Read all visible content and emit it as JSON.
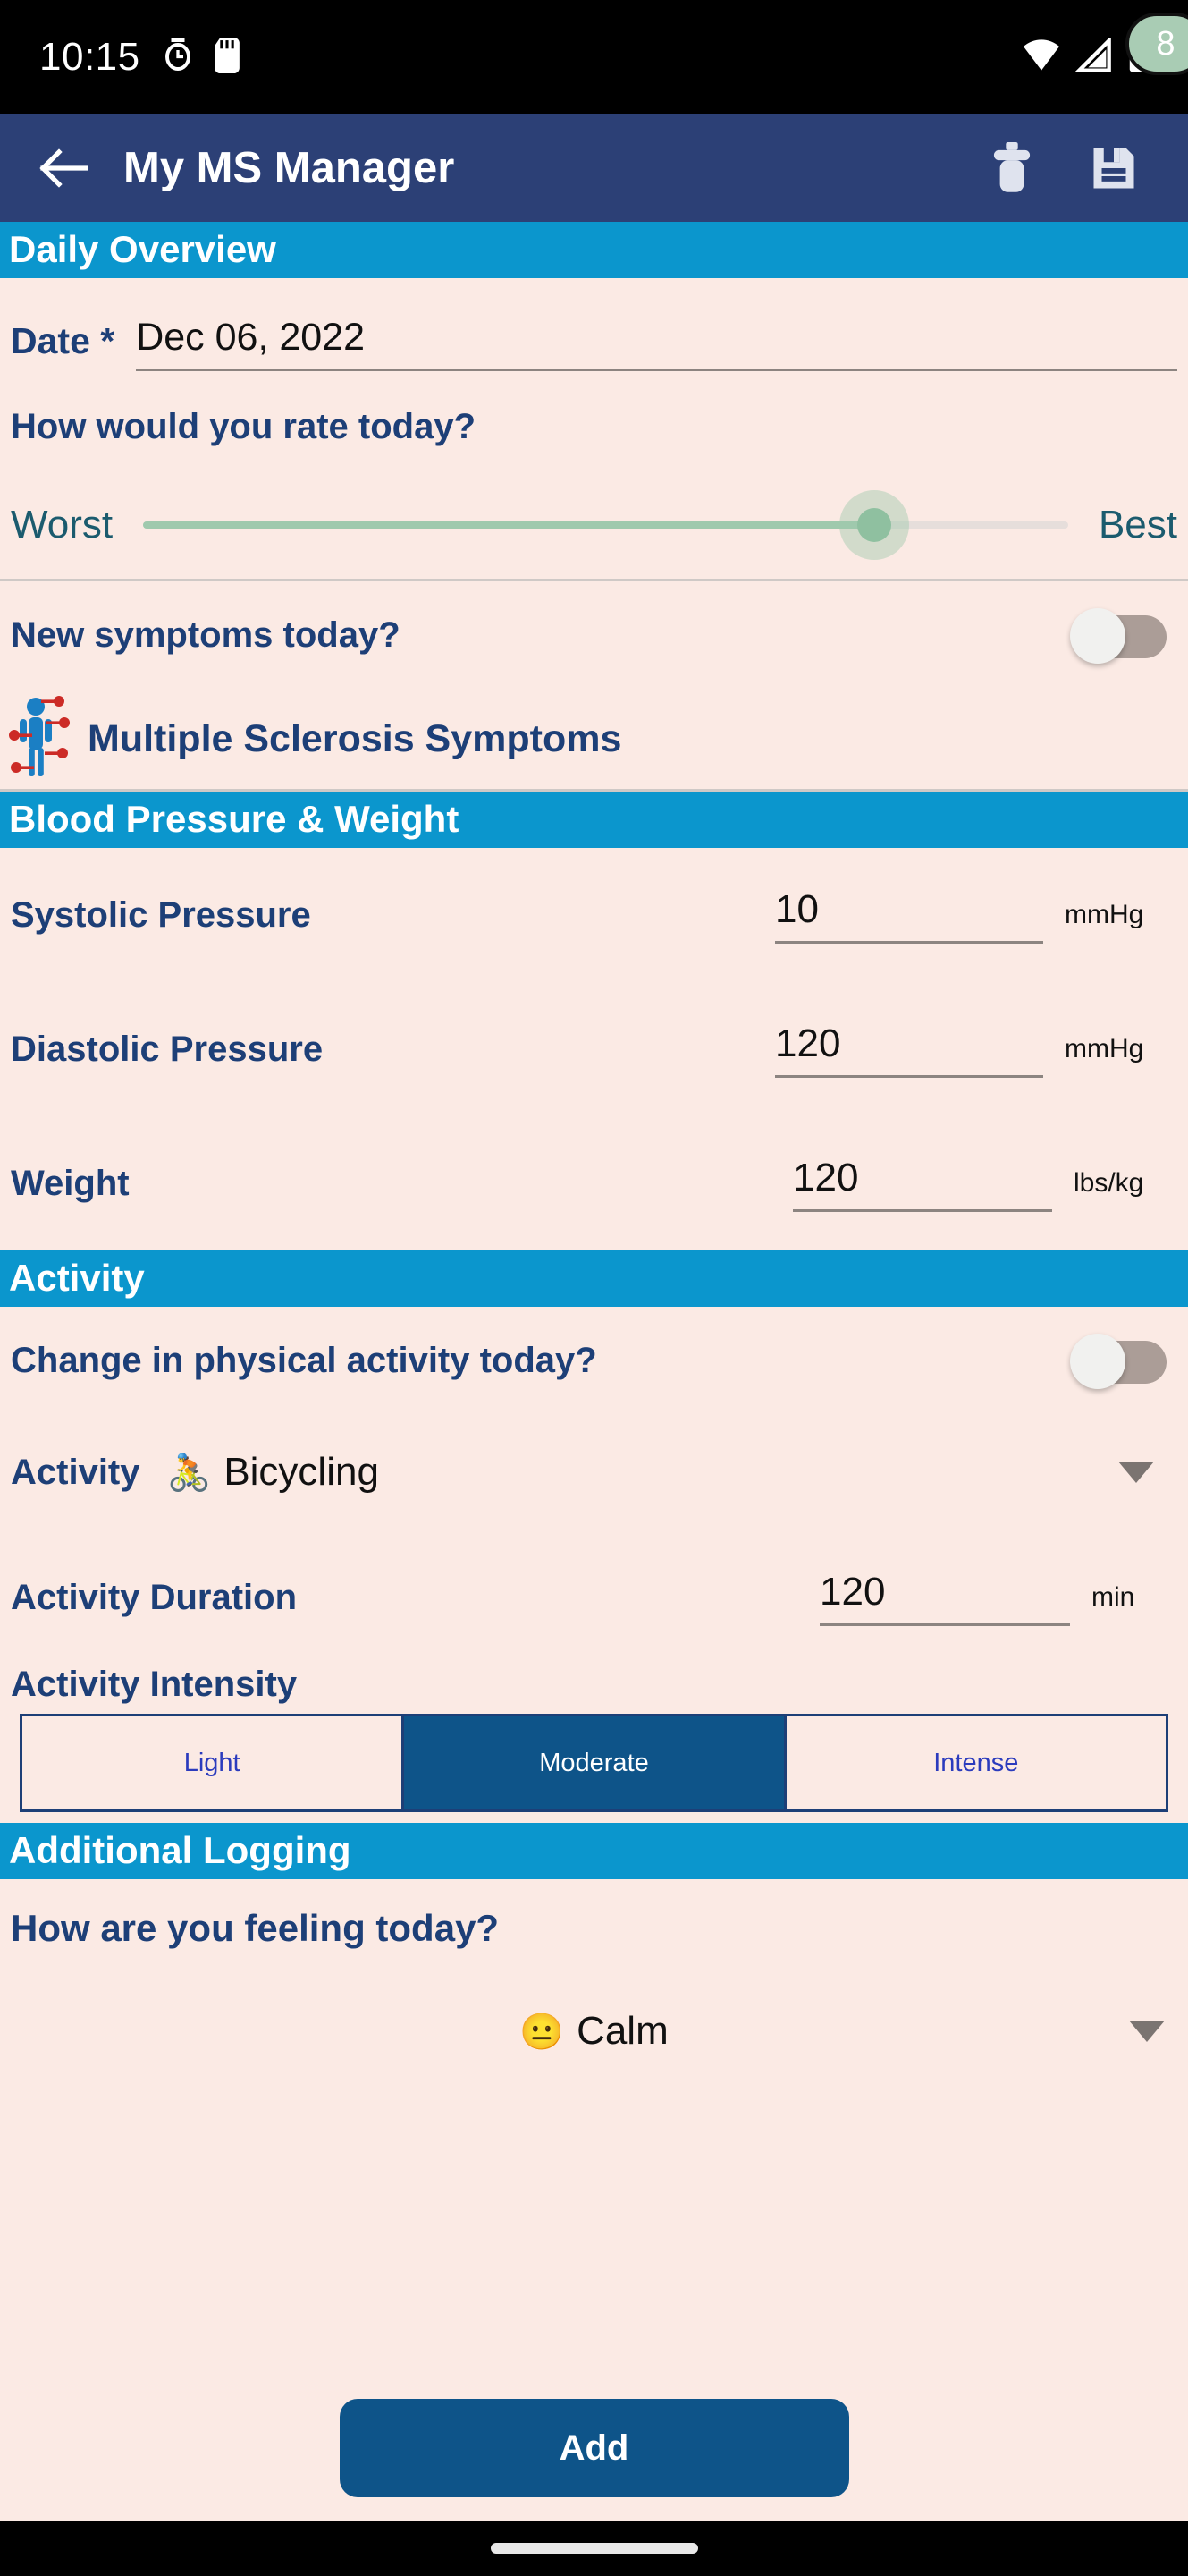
{
  "status_bar": {
    "time": "10:15",
    "left_icons": [
      "alarm-icon",
      "sd-card-icon"
    ],
    "right_icons": [
      "wifi-icon",
      "cellular-signal-icon",
      "battery-icon"
    ]
  },
  "app_bar": {
    "back_label": "back-arrow",
    "title": "My MS Manager",
    "delete_label": "delete-icon",
    "save_label": "save-icon"
  },
  "sections": {
    "daily_overview": {
      "header": "Daily Overview",
      "date_label": "Date *",
      "date_value": "Dec 06, 2022",
      "rate_question": "How would you rate today?",
      "rate_value": "8",
      "rate_min_label": "Worst",
      "rate_max_label": "Best",
      "rate_percent": 80,
      "new_symptoms_label": "New symptoms today?",
      "new_symptoms_on": false,
      "symptoms_link": "Multiple Sclerosis Symptoms"
    },
    "blood_pressure_weight": {
      "header": "Blood Pressure & Weight",
      "fields": [
        {
          "label": "Systolic Pressure",
          "value": "10",
          "unit": "mmHg"
        },
        {
          "label": "Diastolic Pressure",
          "value": "120",
          "unit": "mmHg"
        },
        {
          "label": "Weight",
          "value": "120",
          "unit": "lbs/kg"
        }
      ]
    },
    "activity": {
      "header": "Activity",
      "change_label": "Change in physical activity today?",
      "change_on": false,
      "activity_label": "Activity",
      "activity_emoji": "🚴",
      "activity_value": "Bicycling",
      "duration_label": "Activity Duration",
      "duration_value": "120",
      "duration_unit": "min",
      "intensity_label": "Activity Intensity",
      "intensity_options": [
        "Light",
        "Moderate",
        "Intense"
      ],
      "intensity_selected": "Moderate"
    },
    "additional_logging": {
      "header": "Additional Logging",
      "feeling_question": "How are you feeling today?",
      "mood_emoji": "😐",
      "mood_value": "Calm"
    }
  },
  "bottom_button": {
    "label": "Add"
  },
  "colors": {
    "app_bar": "#2c4076",
    "section_header": "#0b96cd",
    "page_background": "#fbeae4",
    "label_blue": "#1d3f77",
    "accent_dark_blue": "#0e5489",
    "slider_green": "#9fc9ad",
    "badge_green": "#a9ccb4"
  }
}
